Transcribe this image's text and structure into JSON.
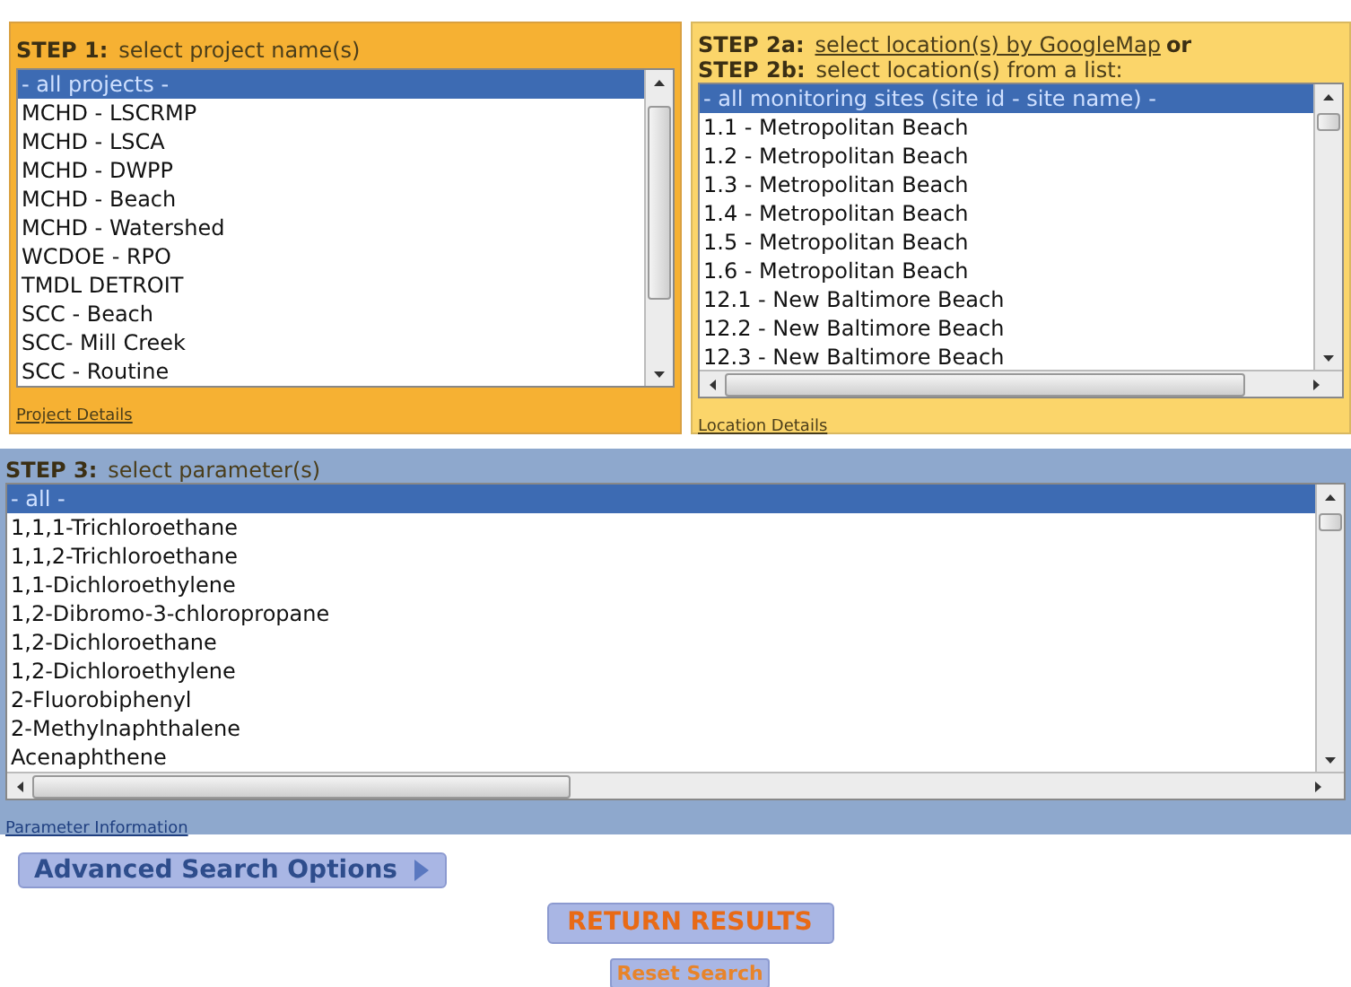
{
  "step1": {
    "headings": [
      {
        "step": "STEP 1:",
        "text": "select project name(s)"
      }
    ],
    "list": [
      {
        "label": "- all projects -",
        "selected": true
      },
      {
        "label": "MCHD - LSCRMP",
        "selected": false
      },
      {
        "label": "MCHD - LSCA",
        "selected": false
      },
      {
        "label": "MCHD - DWPP",
        "selected": false
      },
      {
        "label": "MCHD - Beach",
        "selected": false
      },
      {
        "label": "MCHD - Watershed",
        "selected": false
      },
      {
        "label": "WCDOE - RPO",
        "selected": false
      },
      {
        "label": "TMDL DETROIT",
        "selected": false
      },
      {
        "label": "SCC - Beach",
        "selected": false
      },
      {
        "label": "SCC- Mill Creek",
        "selected": false
      },
      {
        "label": "SCC - Routine",
        "selected": false
      }
    ],
    "footer_link": "Project Details"
  },
  "step2": {
    "headings": [
      {
        "step": "STEP 2a:",
        "link": "select location(s) by GoogleMap",
        "after": "or"
      },
      {
        "step": "STEP 2b:",
        "text": "select location(s) from a list:"
      }
    ],
    "list": [
      {
        "label": "- all monitoring sites (site id - site name) -",
        "selected": true
      },
      {
        "label": "1.1 - Metropolitan Beach",
        "selected": false
      },
      {
        "label": "1.2 - Metropolitan Beach",
        "selected": false
      },
      {
        "label": "1.3 - Metropolitan Beach",
        "selected": false
      },
      {
        "label": "1.4 - Metropolitan Beach",
        "selected": false
      },
      {
        "label": "1.5 - Metropolitan Beach",
        "selected": false
      },
      {
        "label": "1.6 - Metropolitan Beach",
        "selected": false
      },
      {
        "label": "12.1 - New Baltimore Beach",
        "selected": false
      },
      {
        "label": "12.2 - New Baltimore Beach",
        "selected": false
      },
      {
        "label": "12.3 - New Baltimore Beach",
        "selected": false
      }
    ],
    "footer_link": "Location Details"
  },
  "step3": {
    "headings": [
      {
        "step": "STEP 3:",
        "text": "select parameter(s)"
      }
    ],
    "list": [
      {
        "label": "- all -",
        "selected": true
      },
      {
        "label": "1,1,1-Trichloroethane",
        "selected": false
      },
      {
        "label": "1,1,2-Trichloroethane",
        "selected": false
      },
      {
        "label": "1,1-Dichloroethylene",
        "selected": false
      },
      {
        "label": "1,2-Dibromo-3-chloropropane",
        "selected": false
      },
      {
        "label": "1,2-Dichloroethane",
        "selected": false
      },
      {
        "label": "1,2-Dichloroethylene",
        "selected": false
      },
      {
        "label": "2-Fluorobiphenyl",
        "selected": false
      },
      {
        "label": "2-Methylnaphthalene",
        "selected": false
      },
      {
        "label": "Acenaphthene",
        "selected": false
      }
    ],
    "footer_link": "Parameter Information"
  },
  "advanced_button": "Advanced Search Options",
  "return_button": "RETURN RESULTS",
  "reset_button": "Reset Search"
}
